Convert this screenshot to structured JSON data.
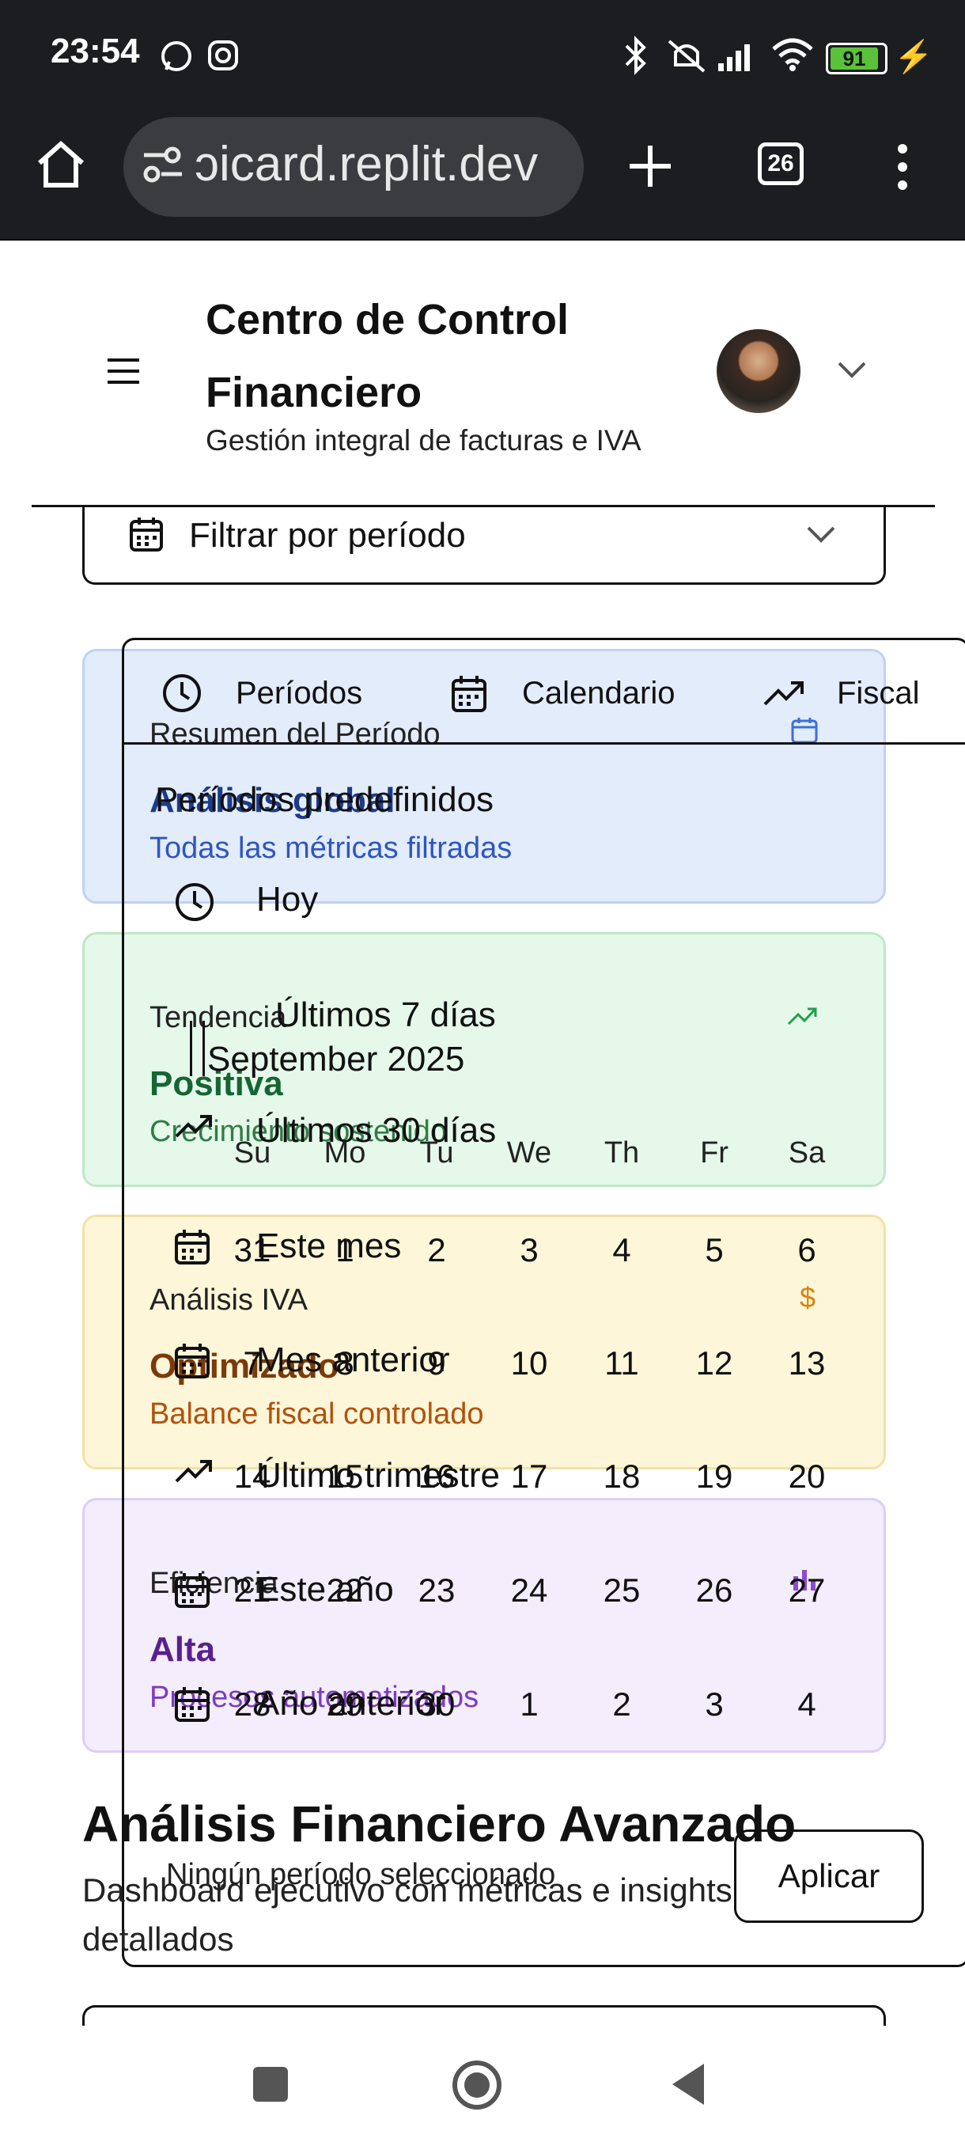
{
  "status_bar": {
    "time": "23:54",
    "battery": "91"
  },
  "browser": {
    "url": "ɔicard.replit.dev",
    "tab_count": "26"
  },
  "header": {
    "title_line1": "Centro de Control",
    "title_line2": "Financiero",
    "subtitle": "Gestión integral de facturas e IVA"
  },
  "filter": {
    "label": "Filtrar por período"
  },
  "cards": [
    {
      "title": "Resumen del Período",
      "value": "Análisis global",
      "sub": "Todas las métricas filtradas",
      "bg": "#e3ecfb",
      "border": "#bfd2f4",
      "value_color": "#1e3a8a",
      "sub_color": "#2f55c0",
      "icon_color": "#3b6fd8"
    },
    {
      "title": "Tendencia",
      "value": "Positiva",
      "sub": "Crecimiento sostenido",
      "bg": "#e5f8ea",
      "border": "#bde9c8",
      "value_color": "#166534",
      "sub_color": "#2f7d45",
      "icon_color": "#22a04b"
    },
    {
      "title": "Análisis IVA",
      "value": "Optimizado",
      "sub": "Balance fiscal controlado",
      "bg": "#fdf6d9",
      "border": "#f3e2a2",
      "value_color": "#7c3a0a",
      "sub_color": "#b2520c",
      "icon_color": "#d8830d"
    },
    {
      "title": "Eficiencia",
      "value": "Alta",
      "sub": "Procesos automatizados",
      "bg": "#f3edfc",
      "border": "#dccff5",
      "value_color": "#5b1f8e",
      "sub_color": "#7d3bbf",
      "icon_color": "#8a4bd0"
    }
  ],
  "popup": {
    "tabs": [
      "Períodos",
      "Calendario",
      "Fiscal"
    ],
    "presets_heading": "Períodos predefinidos",
    "presets": [
      "Hoy",
      "Últimos 7 días",
      "Últimos 30 días",
      "Este mes",
      "Mes anterior",
      "Último trimestre",
      "Este año",
      "Año anterior"
    ],
    "calendar": {
      "month": "September 2025",
      "weekdays": [
        "Su",
        "Mo",
        "Tu",
        "We",
        "Th",
        "Fr",
        "Sa"
      ],
      "weeks": [
        [
          "31",
          "1",
          "2",
          "3",
          "4",
          "5",
          "6"
        ],
        [
          "7",
          "8",
          "9",
          "10",
          "11",
          "12",
          "13"
        ],
        [
          "14",
          "15",
          "16",
          "17",
          "18",
          "19",
          "20"
        ],
        [
          "21",
          "22",
          "23",
          "24",
          "25",
          "26",
          "27"
        ],
        [
          "28",
          "29",
          "30",
          "1",
          "2",
          "3",
          "4"
        ]
      ]
    },
    "status": "Ningún período seleccionado",
    "apply": "Aplicar"
  },
  "section": {
    "title": "Análisis Financiero Avanzado",
    "subtitle": "Dashboard ejecutivo con métricas e insights detallados"
  }
}
